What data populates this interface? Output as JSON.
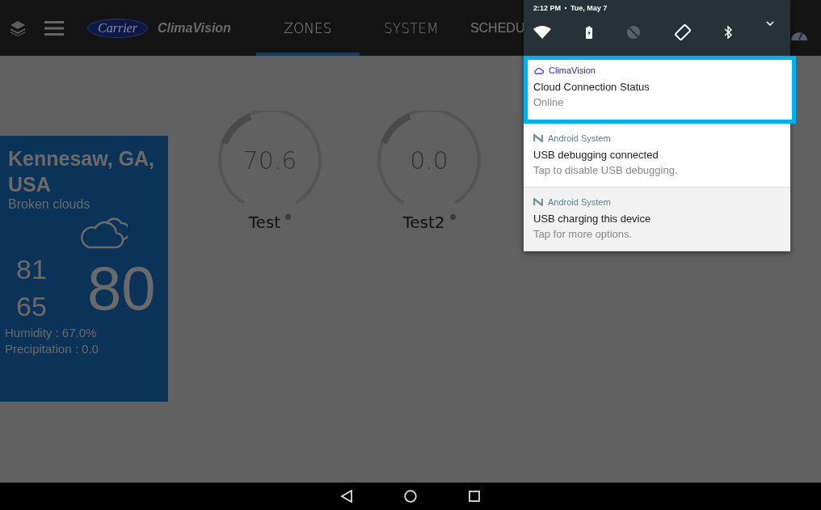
{
  "app_bar": {
    "brand": "Carrier",
    "product": "ClimaVision",
    "tabs": [
      {
        "label": "ZONES",
        "selected": true
      },
      {
        "label": "SYSTEM",
        "selected": false
      },
      {
        "label": "SCHEDU",
        "selected": false
      }
    ]
  },
  "weather": {
    "location": "Kennesaw, GA, USA",
    "condition": "Broken clouds",
    "high": "81",
    "low": "65",
    "current": "80",
    "humidity": "Humidity : 67.0%",
    "precipitation": "Precipitation : 0.0"
  },
  "zones": [
    {
      "name": "Test",
      "value": "70.6"
    },
    {
      "name": "Test2",
      "value": "0.0"
    }
  ],
  "shade": {
    "time": "2:12 PM",
    "date": "Tue, May 7",
    "notifications": [
      {
        "kind": "app",
        "app": "ClimaVision",
        "title": "Cloud Connection Status",
        "text": "Online",
        "selected": true
      },
      {
        "kind": "system",
        "app": "Android System",
        "title": "USB debugging connected",
        "text": "Tap to disable USB debugging.",
        "selected": false
      },
      {
        "kind": "system",
        "app": "Android System",
        "title": "USB charging this device",
        "text": "Tap for more options.",
        "selected": false
      }
    ]
  }
}
